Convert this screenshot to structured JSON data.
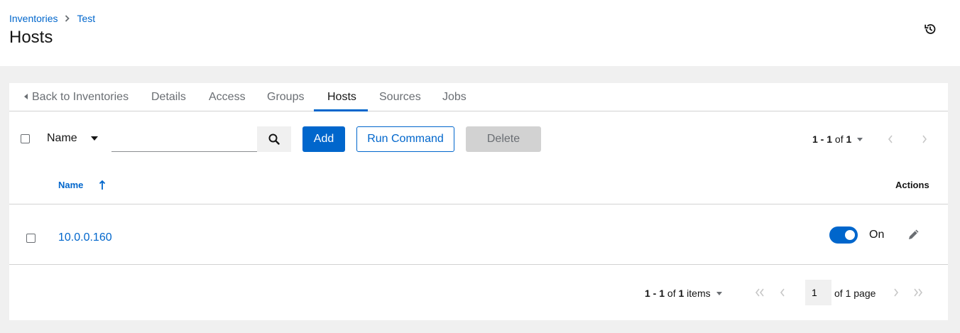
{
  "breadcrumb": {
    "root": "Inventories",
    "current": "Test"
  },
  "page": {
    "title": "Hosts"
  },
  "tabs": [
    {
      "label": "Back to Inventories"
    },
    {
      "label": "Details"
    },
    {
      "label": "Access"
    },
    {
      "label": "Groups"
    },
    {
      "label": "Hosts",
      "active": true
    },
    {
      "label": "Sources"
    },
    {
      "label": "Jobs"
    }
  ],
  "toolbar": {
    "filter_label": "Name",
    "search_value": "",
    "add_label": "Add",
    "run_command_label": "Run Command",
    "delete_label": "Delete",
    "pagination_range": "1 - 1",
    "pagination_of": "of",
    "pagination_total": "1"
  },
  "table": {
    "columns": {
      "name": "Name",
      "actions": "Actions"
    },
    "rows": [
      {
        "name": "10.0.0.160",
        "enabled_label": "On",
        "enabled": true
      }
    ]
  },
  "footer": {
    "range": "1 - 1",
    "of": "of",
    "total": "1",
    "items_label": "items",
    "page_value": "1",
    "of_pages": "of 1 page"
  },
  "colors": {
    "primary": "#0066cc",
    "disabled": "#d2d2d2",
    "background": "#f0f0f0"
  }
}
